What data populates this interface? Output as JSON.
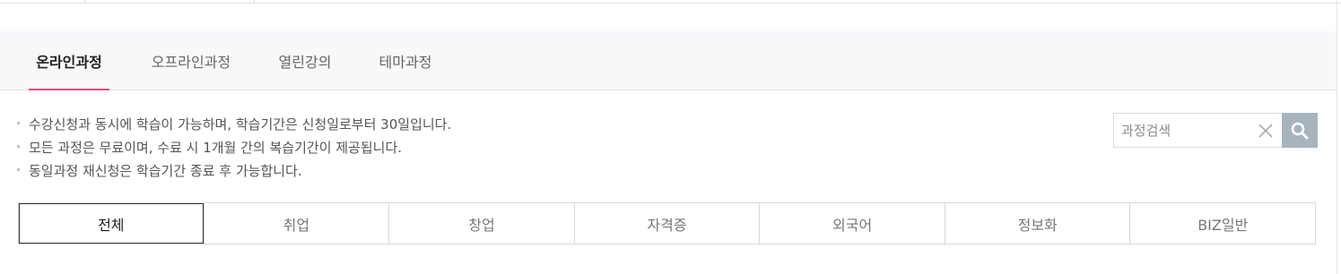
{
  "tabs": [
    {
      "label": "온라인과정",
      "active": true
    },
    {
      "label": "오프라인과정",
      "active": false
    },
    {
      "label": "열린강의",
      "active": false
    },
    {
      "label": "테마과정",
      "active": false
    }
  ],
  "notices": [
    "수강신청과 동시에 학습이 가능하며, 학습기간은 신청일로부터 30일입니다.",
    "모든 과정은 무료이며, 수료 시 1개월 간의 복습기간이 제공됩니다.",
    "동일과정 재신청은 학습기간 종료 후 가능합니다."
  ],
  "search": {
    "placeholder": "과정검색",
    "value": "",
    "clear_icon": "close-icon",
    "button_icon": "search-icon"
  },
  "categories": [
    {
      "label": "전체",
      "active": true
    },
    {
      "label": "취업",
      "active": false
    },
    {
      "label": "창업",
      "active": false
    },
    {
      "label": "자격증",
      "active": false
    },
    {
      "label": "외국어",
      "active": false
    },
    {
      "label": "정보화",
      "active": false
    },
    {
      "label": "BIZ일반",
      "active": false
    }
  ],
  "colors": {
    "accent": "#e8487b",
    "tab_band_bg": "#f8f8fb",
    "search_button_bg": "#a7b4be"
  }
}
